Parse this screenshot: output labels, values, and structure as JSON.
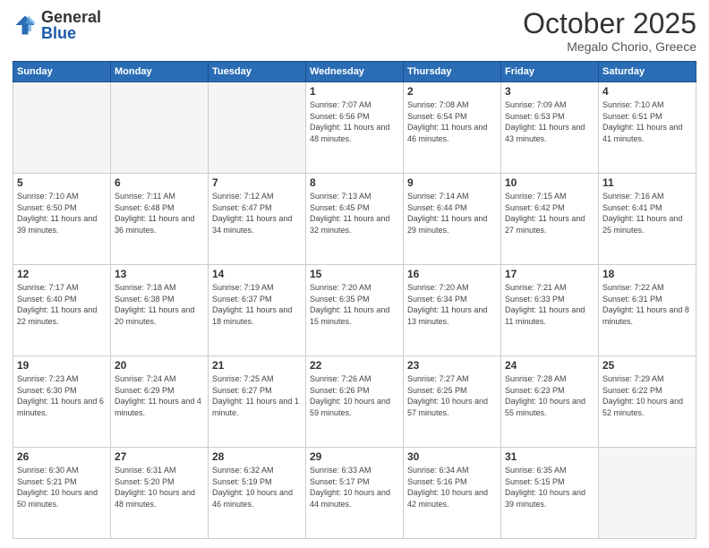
{
  "header": {
    "logo_general": "General",
    "logo_blue": "Blue",
    "month_title": "October 2025",
    "subtitle": "Megalo Chorio, Greece"
  },
  "days_of_week": [
    "Sunday",
    "Monday",
    "Tuesday",
    "Wednesday",
    "Thursday",
    "Friday",
    "Saturday"
  ],
  "weeks": [
    [
      {
        "day": "",
        "info": ""
      },
      {
        "day": "",
        "info": ""
      },
      {
        "day": "",
        "info": ""
      },
      {
        "day": "1",
        "info": "Sunrise: 7:07 AM\nSunset: 6:56 PM\nDaylight: 11 hours and 48 minutes."
      },
      {
        "day": "2",
        "info": "Sunrise: 7:08 AM\nSunset: 6:54 PM\nDaylight: 11 hours and 46 minutes."
      },
      {
        "day": "3",
        "info": "Sunrise: 7:09 AM\nSunset: 6:53 PM\nDaylight: 11 hours and 43 minutes."
      },
      {
        "day": "4",
        "info": "Sunrise: 7:10 AM\nSunset: 6:51 PM\nDaylight: 11 hours and 41 minutes."
      }
    ],
    [
      {
        "day": "5",
        "info": "Sunrise: 7:10 AM\nSunset: 6:50 PM\nDaylight: 11 hours and 39 minutes."
      },
      {
        "day": "6",
        "info": "Sunrise: 7:11 AM\nSunset: 6:48 PM\nDaylight: 11 hours and 36 minutes."
      },
      {
        "day": "7",
        "info": "Sunrise: 7:12 AM\nSunset: 6:47 PM\nDaylight: 11 hours and 34 minutes."
      },
      {
        "day": "8",
        "info": "Sunrise: 7:13 AM\nSunset: 6:45 PM\nDaylight: 11 hours and 32 minutes."
      },
      {
        "day": "9",
        "info": "Sunrise: 7:14 AM\nSunset: 6:44 PM\nDaylight: 11 hours and 29 minutes."
      },
      {
        "day": "10",
        "info": "Sunrise: 7:15 AM\nSunset: 6:42 PM\nDaylight: 11 hours and 27 minutes."
      },
      {
        "day": "11",
        "info": "Sunrise: 7:16 AM\nSunset: 6:41 PM\nDaylight: 11 hours and 25 minutes."
      }
    ],
    [
      {
        "day": "12",
        "info": "Sunrise: 7:17 AM\nSunset: 6:40 PM\nDaylight: 11 hours and 22 minutes."
      },
      {
        "day": "13",
        "info": "Sunrise: 7:18 AM\nSunset: 6:38 PM\nDaylight: 11 hours and 20 minutes."
      },
      {
        "day": "14",
        "info": "Sunrise: 7:19 AM\nSunset: 6:37 PM\nDaylight: 11 hours and 18 minutes."
      },
      {
        "day": "15",
        "info": "Sunrise: 7:20 AM\nSunset: 6:35 PM\nDaylight: 11 hours and 15 minutes."
      },
      {
        "day": "16",
        "info": "Sunrise: 7:20 AM\nSunset: 6:34 PM\nDaylight: 11 hours and 13 minutes."
      },
      {
        "day": "17",
        "info": "Sunrise: 7:21 AM\nSunset: 6:33 PM\nDaylight: 11 hours and 11 minutes."
      },
      {
        "day": "18",
        "info": "Sunrise: 7:22 AM\nSunset: 6:31 PM\nDaylight: 11 hours and 8 minutes."
      }
    ],
    [
      {
        "day": "19",
        "info": "Sunrise: 7:23 AM\nSunset: 6:30 PM\nDaylight: 11 hours and 6 minutes."
      },
      {
        "day": "20",
        "info": "Sunrise: 7:24 AM\nSunset: 6:29 PM\nDaylight: 11 hours and 4 minutes."
      },
      {
        "day": "21",
        "info": "Sunrise: 7:25 AM\nSunset: 6:27 PM\nDaylight: 11 hours and 1 minute."
      },
      {
        "day": "22",
        "info": "Sunrise: 7:26 AM\nSunset: 6:26 PM\nDaylight: 10 hours and 59 minutes."
      },
      {
        "day": "23",
        "info": "Sunrise: 7:27 AM\nSunset: 6:25 PM\nDaylight: 10 hours and 57 minutes."
      },
      {
        "day": "24",
        "info": "Sunrise: 7:28 AM\nSunset: 6:23 PM\nDaylight: 10 hours and 55 minutes."
      },
      {
        "day": "25",
        "info": "Sunrise: 7:29 AM\nSunset: 6:22 PM\nDaylight: 10 hours and 52 minutes."
      }
    ],
    [
      {
        "day": "26",
        "info": "Sunrise: 6:30 AM\nSunset: 5:21 PM\nDaylight: 10 hours and 50 minutes."
      },
      {
        "day": "27",
        "info": "Sunrise: 6:31 AM\nSunset: 5:20 PM\nDaylight: 10 hours and 48 minutes."
      },
      {
        "day": "28",
        "info": "Sunrise: 6:32 AM\nSunset: 5:19 PM\nDaylight: 10 hours and 46 minutes."
      },
      {
        "day": "29",
        "info": "Sunrise: 6:33 AM\nSunset: 5:17 PM\nDaylight: 10 hours and 44 minutes."
      },
      {
        "day": "30",
        "info": "Sunrise: 6:34 AM\nSunset: 5:16 PM\nDaylight: 10 hours and 42 minutes."
      },
      {
        "day": "31",
        "info": "Sunrise: 6:35 AM\nSunset: 5:15 PM\nDaylight: 10 hours and 39 minutes."
      },
      {
        "day": "",
        "info": ""
      }
    ]
  ]
}
